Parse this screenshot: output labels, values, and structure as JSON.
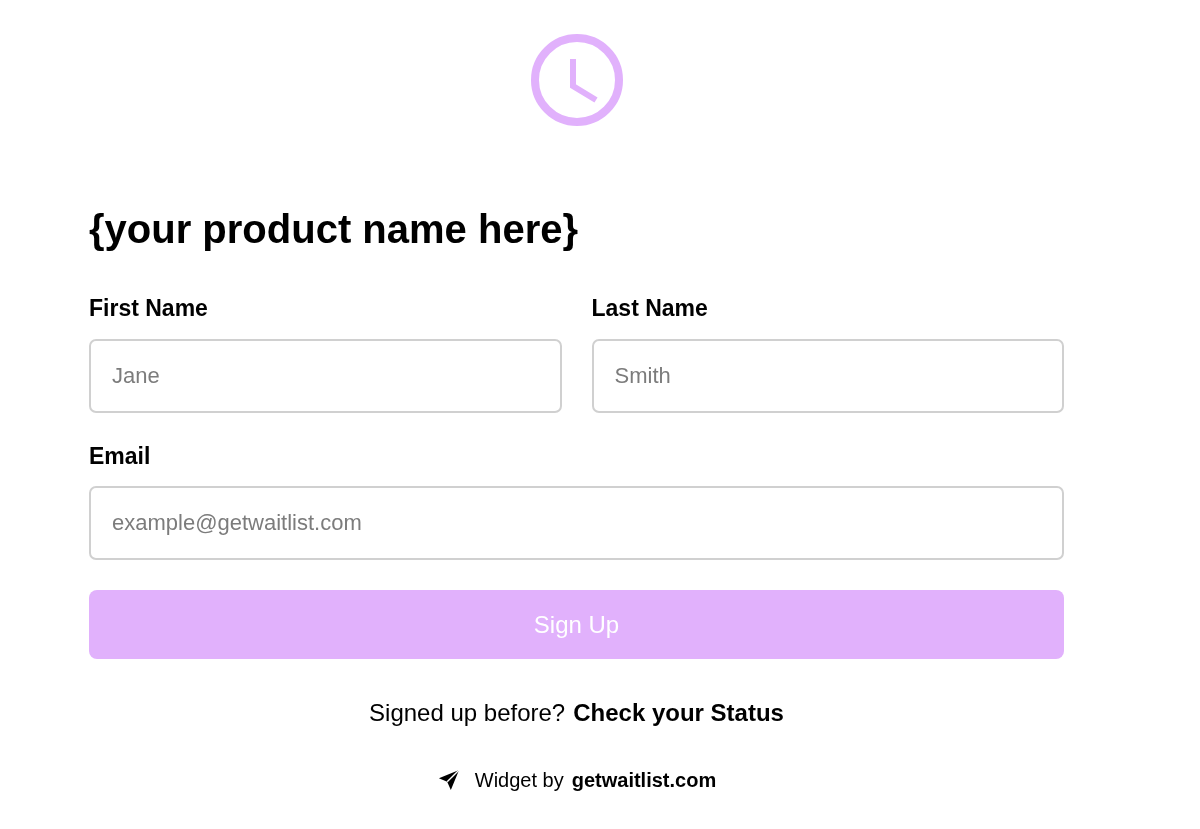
{
  "title": "{your product name here}",
  "fields": [
    {
      "label": "First Name",
      "placeholder": "Jane"
    },
    {
      "label": "Last Name",
      "placeholder": "Smith"
    },
    {
      "label": "Email",
      "placeholder": "example@getwaitlist.com"
    }
  ],
  "submit": {
    "label": "Sign Up",
    "disabled": true
  },
  "status_prompt": {
    "text": "Signed up before?",
    "link": "Check your Status"
  },
  "credit": {
    "text": "Widget by",
    "link": "getwaitlist.com"
  }
}
